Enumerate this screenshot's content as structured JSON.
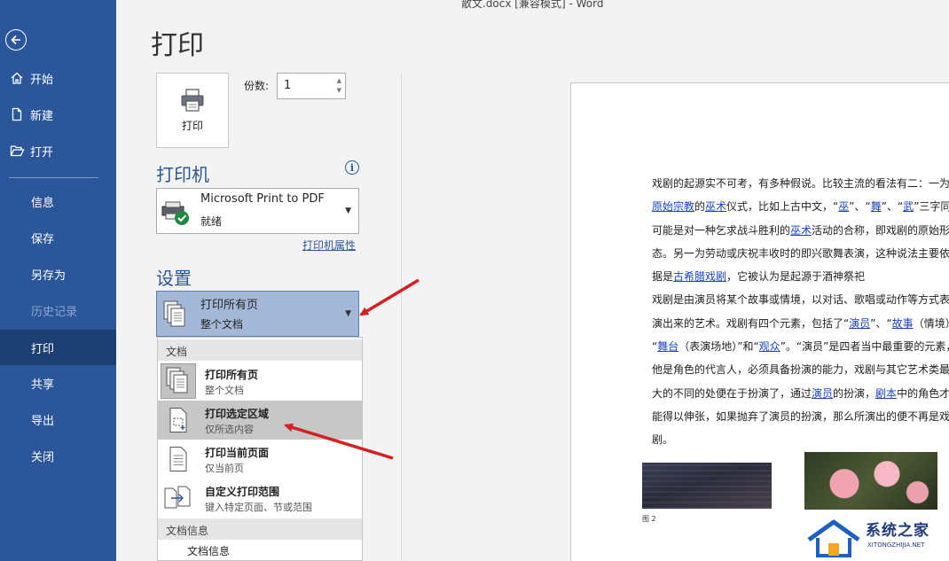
{
  "window": {
    "title": "散文.docx [兼容模式]  -  Word"
  },
  "sidebar": {
    "back_icon": "back-arrow-icon",
    "items": [
      {
        "label": "开始",
        "icon": "home-icon"
      },
      {
        "label": "新建",
        "icon": "new-document-icon"
      },
      {
        "label": "打开",
        "icon": "open-folder-icon"
      },
      {
        "label": "信息"
      },
      {
        "label": "保存"
      },
      {
        "label": "另存为"
      },
      {
        "label": "历史记录",
        "disabled": true
      },
      {
        "label": "打印",
        "active": true
      },
      {
        "label": "共享"
      },
      {
        "label": "导出"
      },
      {
        "label": "关闭"
      }
    ]
  },
  "print": {
    "heading": "打印",
    "print_button_label": "打印",
    "copies_label": "份数:",
    "copies_value": "1"
  },
  "printer": {
    "section_title": "打印机",
    "name": "Microsoft Print to PDF",
    "status": "就绪",
    "properties_link": "打印机属性"
  },
  "settings": {
    "section_title": "设置",
    "selected_main": "打印所有页",
    "selected_sub": "整个文档"
  },
  "menu": {
    "header_document": "文档",
    "items": [
      {
        "title": "打印所有页",
        "sub": "整个文档"
      },
      {
        "title": "打印选定区域",
        "sub": "仅所选内容"
      },
      {
        "title": "打印当前页面",
        "sub": "仅当前页"
      },
      {
        "title": "自定义打印范围",
        "sub": "键入特定页面、节或范围"
      }
    ],
    "header_docinfo": "文档信息",
    "docinfo_item": "文档信息"
  },
  "preview": {
    "lines": [
      [
        "戏剧的起源实不可考，有多种假说。比较主流的看法有二：一为"
      ],
      [
        {
          "link": "原始宗教"
        },
        "的",
        {
          "link": "巫术"
        },
        "仪式，比如上古中文，“",
        {
          "link": "巫"
        },
        "”、“",
        {
          "link": "舞"
        },
        "”、“",
        {
          "link": "武"
        },
        "”三字同源，"
      ],
      [
        "可能是对一种乞求战斗胜利的",
        {
          "link": "巫术"
        },
        "活动的合称，即戏剧的原始形"
      ],
      [
        "态。另一为劳动或庆祝丰收时的即兴歌舞表演，这种说法主要依"
      ],
      [
        "据是",
        {
          "link": "古希腊戏剧"
        },
        "，它被认为是起源于酒神祭祀"
      ],
      [
        "戏剧是由演员将某个故事或情境，以对话、歌唱或动作等方式表"
      ],
      [
        "演出来的艺术。戏剧有四个元素，包括了“",
        {
          "link": "演员"
        },
        "”、“",
        {
          "link": "故事"
        },
        "（情境）”、"
      ],
      [
        "“",
        {
          "link": "舞台"
        },
        "（表演场地）”和“",
        {
          "link": "观众"
        },
        "”。“演员”是四者当中最重要的元素，"
      ],
      [
        "他是角色的代言人，必须具备扮演的能力，戏剧与其它艺术类最"
      ],
      [
        "大的不同的处便在于扮演了，通过",
        {
          "link": "演员"
        },
        "的扮演，",
        {
          "link": "剧本"
        },
        "中的角色才"
      ],
      [
        "能得以伸张，如果抛弃了演员的扮演，那么所演出的便不再是戏"
      ],
      [
        "剧。"
      ]
    ],
    "caption": "图 2"
  },
  "watermark": {
    "text": "系统之家",
    "sub": "XITONGZHIJIA.NET"
  },
  "colors": {
    "sidebar": "#2b579a",
    "accent": "#2b579a",
    "selected_dropdown": "#a3b8d6",
    "annotation_arrow": "#d42020",
    "link": "#1a44c2"
  }
}
